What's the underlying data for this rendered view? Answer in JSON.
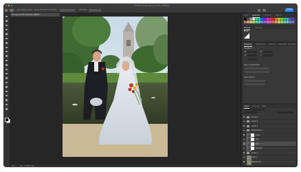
{
  "window": {
    "title": "—  Edited Image.psd @ 25% (RGB/8)",
    "traffic_colors": [
      "#ff5f57",
      "#febc2e",
      "#28c840"
    ]
  },
  "options_bar": {
    "items": [
      "Auto-Select:",
      "Layer",
      "Show Transform Controls",
      "3D Mode:"
    ],
    "share_label": "Share"
  },
  "document": {
    "tab_label": "Scan.psd @ 25% (Colorize, RGB/8) *",
    "zoom": "25%",
    "doc_info": "Doc: 91.2M/1.14G"
  },
  "tools": [
    "move",
    "marquee",
    "lasso",
    "quick-select",
    "crop",
    "frame",
    "eyedropper",
    "healing",
    "brush",
    "stamp",
    "history-brush",
    "eraser",
    "gradient",
    "blur",
    "dodge",
    "pen",
    "type",
    "path-select",
    "rectangle",
    "hand",
    "zoom",
    "more"
  ],
  "panels": {
    "top_tabs": [
      "Color",
      "Swatches",
      "Gradients",
      "Patterns"
    ],
    "brush_tabs": [
      "Brushes",
      "Libraries"
    ],
    "brush_label": "Brush",
    "properties": {
      "tabs": [
        "Properties",
        "Adjustments",
        "Libraries",
        "Paragraph",
        "Character"
      ],
      "section": "Transform",
      "rows": [
        "W",
        "H",
        "X",
        "Y"
      ],
      "align_label": "Align and Distribute",
      "quick_label": "Quick Actions"
    },
    "layers": {
      "tabs": [
        "Layers",
        "Channels",
        "Paths"
      ],
      "rows": [
        {
          "name": "Group 5",
          "kind": "folder",
          "selected": false
        },
        {
          "name": "Group 4",
          "kind": "folder",
          "selected": false
        },
        {
          "name": "Group 3",
          "kind": "folder",
          "selected": false
        },
        {
          "name": "Background 1",
          "kind": "folder",
          "selected": false
        },
        {
          "name": "Dress",
          "kind": "mask",
          "selected": false
        },
        {
          "name": "Suit",
          "kind": "mask",
          "selected": false
        },
        {
          "name": "Skin",
          "kind": "mask",
          "selected": true
        },
        {
          "name": "Bouquet",
          "kind": "mask",
          "selected": false
        },
        {
          "name": "Group 1",
          "kind": "folder",
          "selected": false
        },
        {
          "name": "Layer 1",
          "kind": "thumb",
          "selected": false
        },
        {
          "name": "Background",
          "kind": "thumb",
          "selected": false
        }
      ]
    }
  }
}
